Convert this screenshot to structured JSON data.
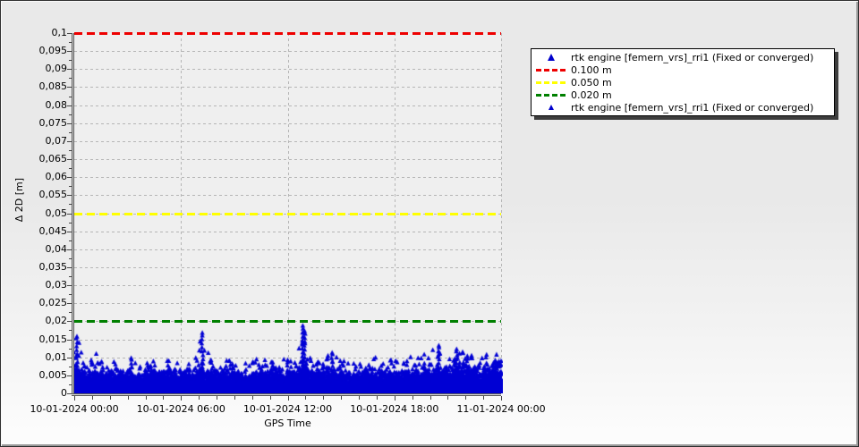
{
  "window": {
    "kind": "chart-viewer"
  },
  "chart_data": {
    "type": "scatter",
    "title": "",
    "xlabel": "GPS Time",
    "ylabel": "Δ 2D [m]",
    "x_tick_labels": [
      "10-01-2024 00:00",
      "10-01-2024 06:00",
      "10-01-2024 12:00",
      "10-01-2024 18:00",
      "11-01-2024 00:00"
    ],
    "x_range_hours": [
      0,
      24
    ],
    "ylim": [
      0,
      0.1
    ],
    "y_tick_step": 0.005,
    "y_tick_labels": [
      "0",
      "0,005",
      "0,01",
      "0,015",
      "0,02",
      "0,025",
      "0,03",
      "0,035",
      "0,04",
      "0,045",
      "0,05",
      "0,055",
      "0,06",
      "0,065",
      "0,07",
      "0,075",
      "0,08",
      "0,085",
      "0,09",
      "0,095",
      "0,1"
    ],
    "grid": true,
    "thresholds": [
      {
        "label": "0.100 m",
        "value": 0.1,
        "color": "#ee0000"
      },
      {
        "label": "0.050 m",
        "value": 0.05,
        "color": "#ffff00"
      },
      {
        "label": "0.020 m",
        "value": 0.02,
        "color": "#008000"
      }
    ],
    "series": [
      {
        "name": "rtk engine [femern_vrs]_rri1 (Fixed or converged)",
        "marker": "triangle",
        "color": "#0000d4",
        "description": "dense band of fixed/converged RTK 2D deltas, baseline 0 to ~0.008 m with occasional spikes to ~0.018 m",
        "envelope": [
          [
            0,
            0.007,
            0.0155
          ],
          [
            0.25,
            0.006,
            0.016
          ],
          [
            0.6,
            0.005,
            0.009
          ],
          [
            1,
            0.005,
            0.01
          ],
          [
            1.3,
            0.0055,
            0.011
          ],
          [
            1.7,
            0.0045,
            0.008
          ],
          [
            2.2,
            0.005,
            0.009
          ],
          [
            2.7,
            0.005,
            0.0085
          ],
          [
            3.2,
            0.0045,
            0.0095
          ],
          [
            3.7,
            0.0045,
            0.008
          ],
          [
            4.2,
            0.005,
            0.009
          ],
          [
            4.7,
            0.005,
            0.0085
          ],
          [
            5.2,
            0.0055,
            0.009
          ],
          [
            5.7,
            0.005,
            0.008
          ],
          [
            6.2,
            0.005,
            0.0095
          ],
          [
            6.7,
            0.005,
            0.009
          ],
          [
            7,
            0.006,
            0.0115
          ],
          [
            7.2,
            0.006,
            0.0165
          ],
          [
            7.5,
            0.0055,
            0.012
          ],
          [
            8,
            0.005,
            0.009
          ],
          [
            8.5,
            0.005,
            0.0085
          ],
          [
            9,
            0.005,
            0.01
          ],
          [
            9.5,
            0.0045,
            0.008
          ],
          [
            10,
            0.005,
            0.009
          ],
          [
            10.5,
            0.005,
            0.0095
          ],
          [
            11,
            0.005,
            0.01
          ],
          [
            11.5,
            0.0055,
            0.011
          ],
          [
            12,
            0.005,
            0.009
          ],
          [
            12.5,
            0.005,
            0.01
          ],
          [
            12.85,
            0.007,
            0.0185
          ],
          [
            13.1,
            0.006,
            0.012
          ],
          [
            13.5,
            0.005,
            0.009
          ],
          [
            14,
            0.005,
            0.01
          ],
          [
            14.5,
            0.005,
            0.011
          ],
          [
            15,
            0.005,
            0.0095
          ],
          [
            15.5,
            0.0045,
            0.008
          ],
          [
            16,
            0.005,
            0.009
          ],
          [
            16.5,
            0.005,
            0.01
          ],
          [
            17,
            0.005,
            0.0105
          ],
          [
            17.5,
            0.005,
            0.009
          ],
          [
            18,
            0.005,
            0.0095
          ],
          [
            18.5,
            0.0055,
            0.011
          ],
          [
            19,
            0.005,
            0.01
          ],
          [
            19.5,
            0.005,
            0.011
          ],
          [
            20,
            0.006,
            0.0115
          ],
          [
            20.5,
            0.006,
            0.013
          ],
          [
            21,
            0.0055,
            0.011
          ],
          [
            21.5,
            0.006,
            0.012
          ],
          [
            22,
            0.0065,
            0.011
          ],
          [
            22.5,
            0.006,
            0.0105
          ],
          [
            23,
            0.006,
            0.011
          ],
          [
            23.5,
            0.0065,
            0.0105
          ],
          [
            24,
            0.007,
            0.0105
          ]
        ],
        "spikes": [
          [
            0.15,
            0.0155
          ],
          [
            3.2,
            0.0095
          ],
          [
            7.2,
            0.0165
          ],
          [
            12.85,
            0.0185
          ],
          [
            12.95,
            0.017
          ],
          [
            14.5,
            0.011
          ],
          [
            20.5,
            0.013
          ],
          [
            21.5,
            0.012
          ]
        ]
      }
    ],
    "legend": {
      "position": "top-right",
      "entries": [
        {
          "type": "marker",
          "color": "#0000cc",
          "label": "rtk engine [femern_vrs]_rri1 (Fixed or converged)"
        },
        {
          "type": "dash",
          "color": "#ee0000",
          "label": "0.100 m"
        },
        {
          "type": "dash",
          "color": "#ffff00",
          "label": "0.050 m"
        },
        {
          "type": "dash",
          "color": "#008000",
          "label": "0.020 m"
        },
        {
          "type": "marker",
          "color": "#0000cc",
          "label": "rtk engine [femern_vrs]_rri1 (Fixed or converged)"
        }
      ]
    }
  }
}
